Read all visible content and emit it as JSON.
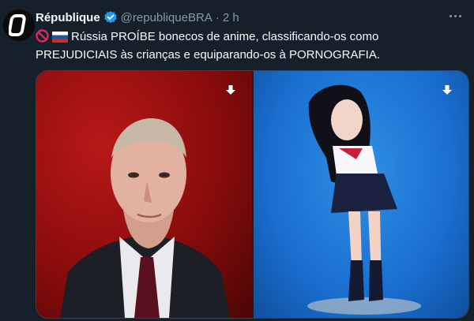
{
  "author": {
    "name": "République",
    "handle": "@republiqueBRA",
    "separator": "·",
    "time": "2 h"
  },
  "tweet": {
    "flag_emoji_prohibited": "🚫",
    "flag_emoji_russia": "🇷🇺",
    "text": "Rússia PROÍBE bonecos de anime, classificando-os como PREJUDICIAIS às crianças e equiparando-os à PORNOGRAFIA."
  },
  "media": [
    {
      "subject": "portrait-man-suit-red-background"
    },
    {
      "subject": "anime-figure-blue-background"
    }
  ],
  "colors": {
    "background": "#15202b",
    "text": "#f7f9f9",
    "muted": "#8b98a5",
    "verified": "#1d9bf0",
    "media_left_bg": "#8a0c0c",
    "media_right_bg": "#1a6fd0"
  },
  "icons": [
    "verified-badge-icon",
    "more-options-icon",
    "download-arrow-icon",
    "prohibited-icon"
  ]
}
